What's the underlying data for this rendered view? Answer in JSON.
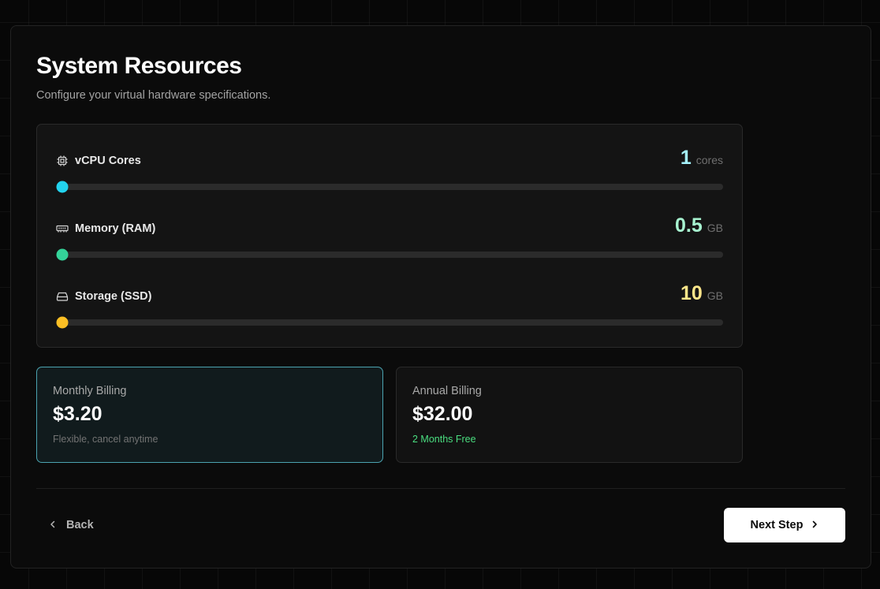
{
  "header": {
    "title": "System Resources",
    "subtitle": "Configure your virtual hardware specifications."
  },
  "resources": [
    {
      "label": "vCPU Cores",
      "value": "1",
      "unit": "cores",
      "icon": "cpu-icon",
      "color": "#22d3ee",
      "level": 0.0
    },
    {
      "label": "Memory (RAM)",
      "value": "0.5",
      "unit": "GB",
      "icon": "memory-icon",
      "color": "#34d399",
      "level": 0.0
    },
    {
      "label": "Storage (SSD)",
      "value": "10",
      "unit": "GB",
      "icon": "storage-icon",
      "color": "#fbbf24",
      "level": 0.0
    }
  ],
  "value_colors": [
    "#a5f3fc",
    "#a7f3d0",
    "#fde68a"
  ],
  "billing": {
    "monthly": {
      "label": "Monthly Billing",
      "price": "$3.20",
      "note": "Flexible, cancel anytime",
      "selected": true
    },
    "annual": {
      "label": "Annual Billing",
      "price": "$32.00",
      "note": "2 Months Free",
      "selected": false
    }
  },
  "footer": {
    "back_label": "Back",
    "next_label": "Next Step"
  },
  "colors": {
    "accent_selected_border": "#4ba3b0",
    "free_badge": "#4ade80"
  }
}
